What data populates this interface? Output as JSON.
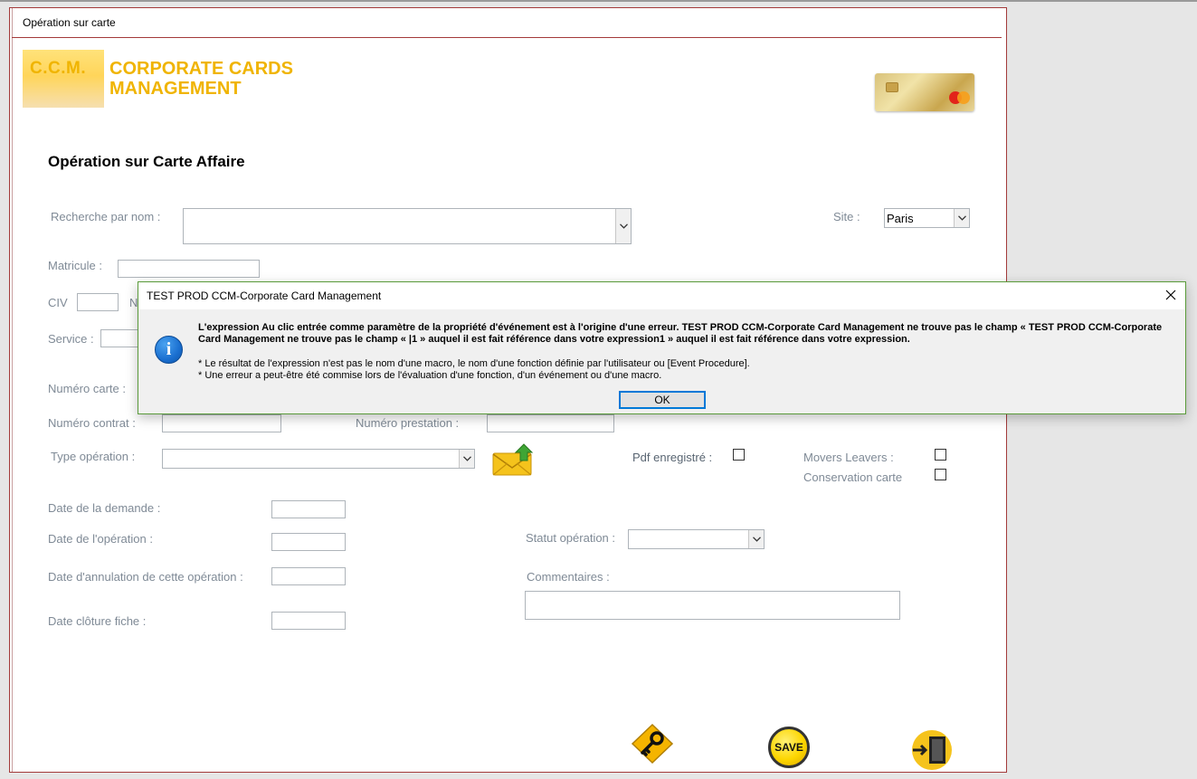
{
  "window": {
    "title": "Opération sur carte"
  },
  "logo": {
    "abbr": "C.C.M.",
    "name": "CORPORATE CARDS\nMANAGEMENT"
  },
  "page": {
    "heading": "Opération sur Carte Affaire"
  },
  "form": {
    "search_label": "Recherche par nom :",
    "search_value": "",
    "site_label": "Site :",
    "site_value": "Paris",
    "matricule_label": "Matricule :",
    "civ_label": "CIV",
    "nom_label_partial": "N",
    "service_label": "Service :",
    "numero_carte_label": "Numéro carte :",
    "numero_contrat_label": "Numéro contrat :",
    "numero_prestation_label": "Numéro prestation :",
    "type_operation_label": "Type opération :",
    "pdf_label": "Pdf enregistré :",
    "movers_label": "Movers Leavers :",
    "conservation_label": "Conservation carte",
    "date_demande_label": "Date de la demande :",
    "date_operation_label": "Date de l'opération :",
    "date_annulation_label": "Date d'annulation de cette opération :",
    "date_cloture_label": "Date clôture fiche :",
    "statut_label": "Statut opération :",
    "commentaires_label": "Commentaires :"
  },
  "actions": {
    "save_label": "SAVE"
  },
  "dialog": {
    "title": "TEST PROD CCM-Corporate Card Management",
    "message": "L'expression Au clic entrée comme paramètre de la propriété d'événement est à l'origine d'une erreur. TEST PROD CCM-Corporate Card Management ne trouve pas le champ « TEST PROD CCM-Corporate Card Management ne trouve pas le champ « |1 » auquel il est fait référence dans votre expression1 » auquel il est fait référence dans votre expression.",
    "note1": "* Le résultat de l'expression n'est pas le nom d'une macro, le nom d'une fonction définie par l'utilisateur ou [Event Procedure].",
    "note2": "* Une erreur a peut-être été commise lors de l'évaluation d'une fonction, d'un événement ou d'une macro.",
    "ok_label": "OK"
  }
}
